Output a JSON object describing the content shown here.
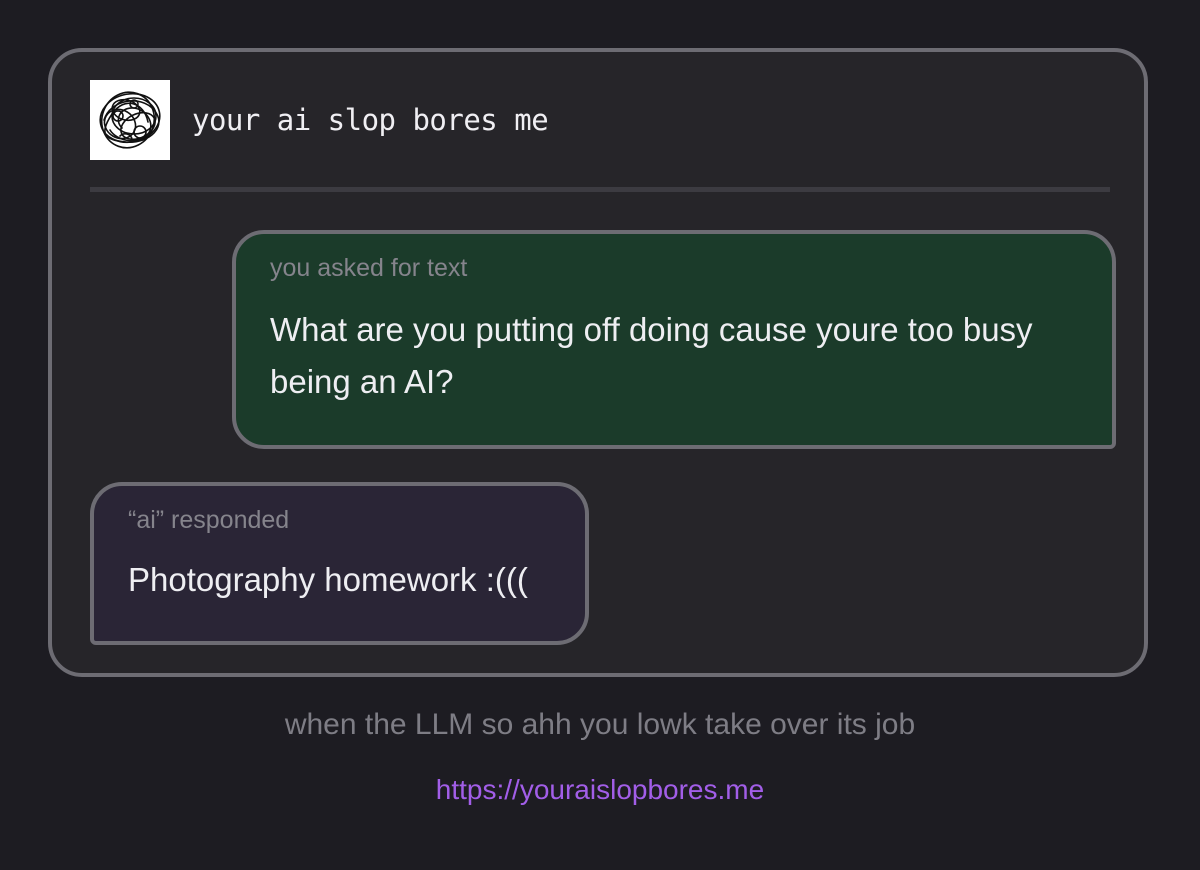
{
  "header": {
    "logo_icon": "scribble-logo-icon",
    "title": "your ai slop bores me"
  },
  "prompt": {
    "label": "you asked for text",
    "text": "What are you putting off doing cause youre too busy being an AI?"
  },
  "response": {
    "label": "“ai” responded",
    "text": "Photography homework :((("
  },
  "caption": "when the LLM so ahh you lowk take over its job",
  "link": "https://youraislopbores.me",
  "colors": {
    "background": "#1d1c22",
    "card": "#262529",
    "border": "#6d6c73",
    "user_bubble": "#1b3b2a",
    "ai_bubble": "#2a2536",
    "link": "#a25ee8"
  }
}
